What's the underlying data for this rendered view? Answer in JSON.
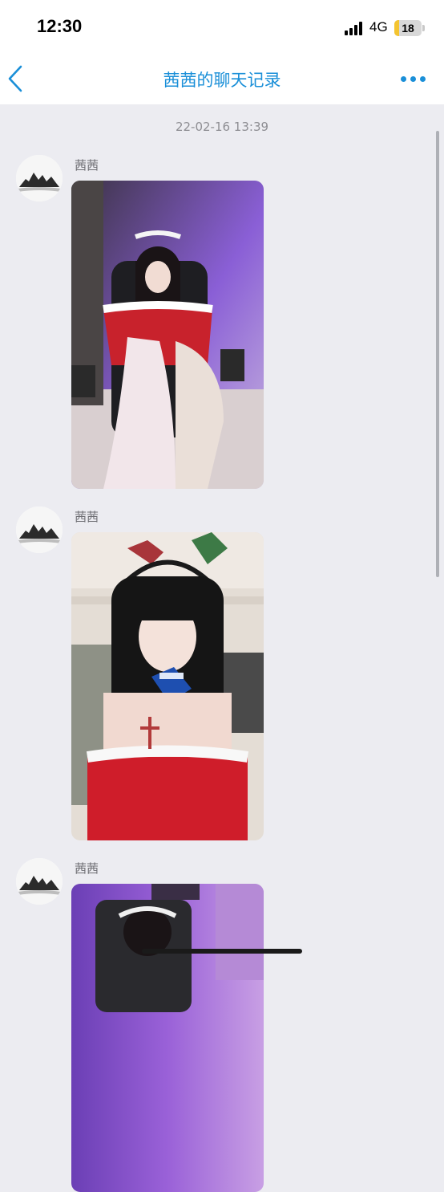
{
  "status_bar": {
    "time": "12:30",
    "network": "4G",
    "battery": "18",
    "battery_level": 0.18
  },
  "nav": {
    "title": "茜茜的聊天记录",
    "back_icon": "chevron-left-icon",
    "more_icon": "more-dots-icon"
  },
  "chat": {
    "timestamp": "22-02-16 13:39",
    "messages": [
      {
        "sender": "茜茜",
        "type": "image"
      },
      {
        "sender": "茜茜",
        "type": "image"
      },
      {
        "sender": "茜茜",
        "type": "image"
      }
    ]
  },
  "colors": {
    "accent": "#1a8fd8",
    "background": "#ececf1"
  }
}
